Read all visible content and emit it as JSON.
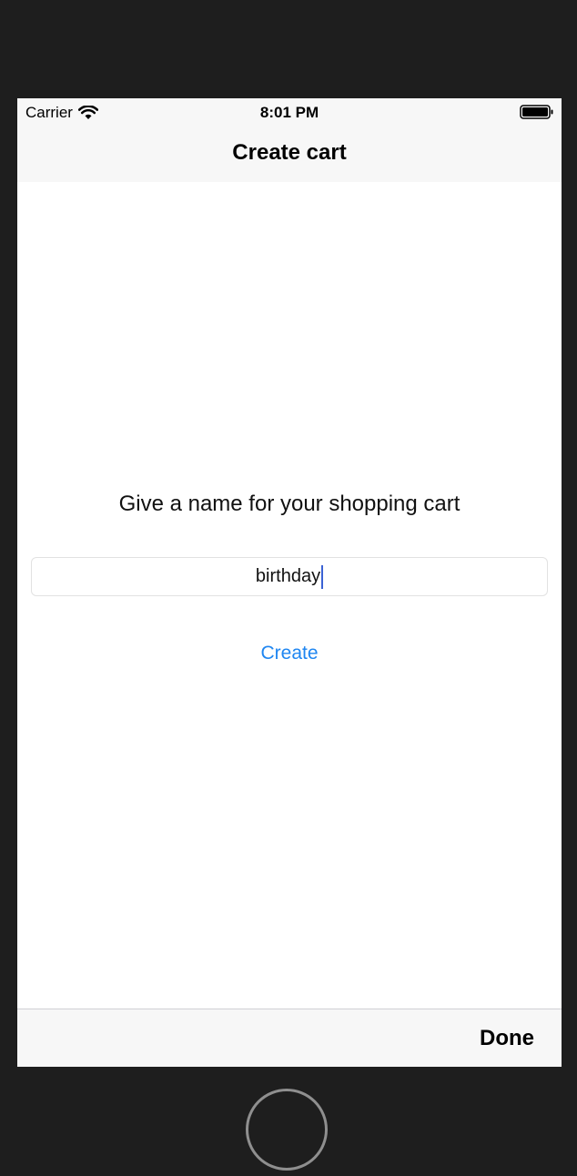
{
  "status_bar": {
    "carrier": "Carrier",
    "time": "8:01 PM"
  },
  "nav_bar": {
    "title": "Create cart"
  },
  "form": {
    "prompt": "Give a name for your shopping cart",
    "name_value": "birthday",
    "create_label": "Create"
  },
  "toolbar": {
    "done_label": "Done"
  },
  "icons": {
    "wifi": "wifi-icon",
    "battery": "battery-icon",
    "home": "home-button"
  },
  "colors": {
    "accent": "#1f86f1",
    "caret": "#3b62d4",
    "bar_background": "#f7f7f7",
    "device_frame": "#1e1e1e"
  }
}
